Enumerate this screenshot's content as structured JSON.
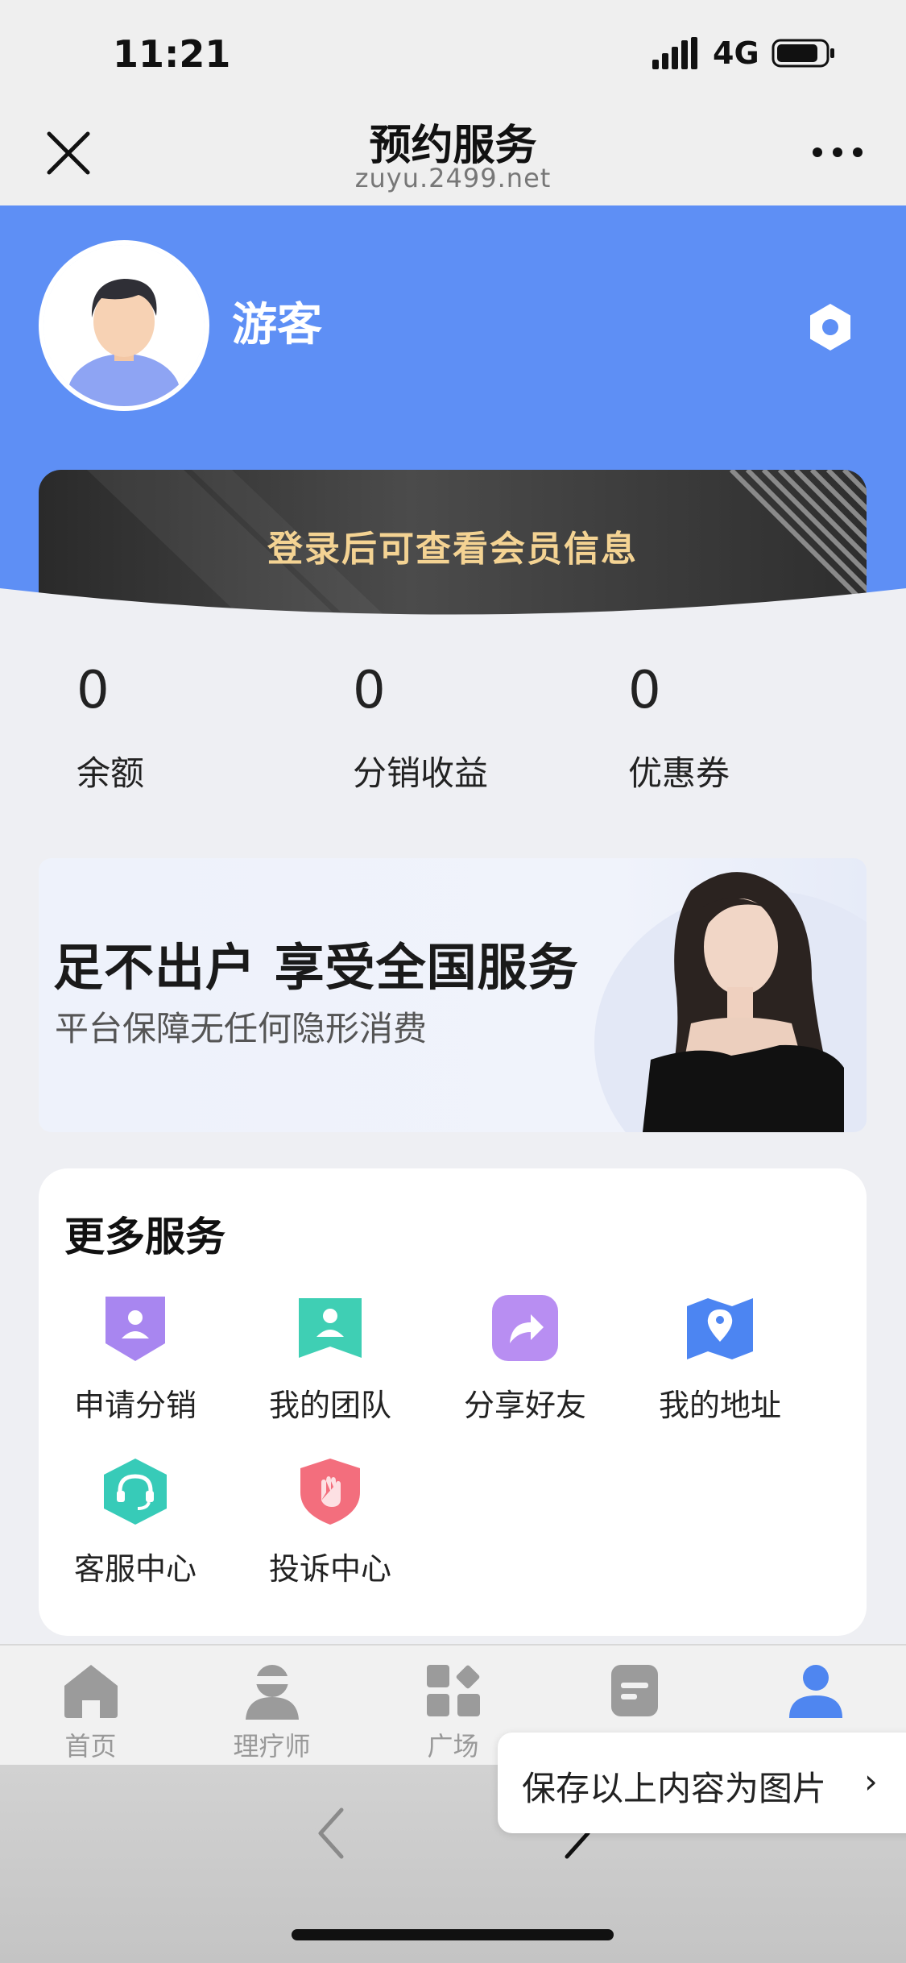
{
  "status_bar": {
    "time": "11:21",
    "network": "4G"
  },
  "header": {
    "title": "预约服务",
    "subtitle": "zuyu.2499.net"
  },
  "profile": {
    "username": "游客",
    "member_prompt": "登录后可查看会员信息"
  },
  "stats": [
    {
      "value": "0",
      "label": "余额"
    },
    {
      "value": "0",
      "label": "分销收益"
    },
    {
      "value": "0",
      "label": "优惠券"
    }
  ],
  "banner": {
    "title": "足不出户 享受全国服务",
    "subtitle": "平台保障无任何隐形消费"
  },
  "services": {
    "title": "更多服务",
    "items": [
      {
        "label": "申请分销",
        "icon": "badge-user-icon"
      },
      {
        "label": "我的团队",
        "icon": "team-icon"
      },
      {
        "label": "分享好友",
        "icon": "share-icon"
      },
      {
        "label": "我的地址",
        "icon": "map-pin-icon"
      },
      {
        "label": "客服中心",
        "icon": "headset-icon"
      },
      {
        "label": "投诉中心",
        "icon": "shield-hand-icon"
      }
    ]
  },
  "tabbar": [
    {
      "label": "首页",
      "icon": "home-icon"
    },
    {
      "label": "理疗师",
      "icon": "therapist-icon"
    },
    {
      "label": "广场",
      "icon": "grid-icon"
    },
    {
      "label": "",
      "icon": "orders-icon"
    },
    {
      "label": "",
      "icon": "profile-icon",
      "active": true
    }
  ],
  "save_popup": {
    "text": "保存以上内容为图片",
    "chevron": "›"
  },
  "colors": {
    "brand_blue": "#5e8ff5",
    "gold_text": "#f4d393",
    "tab_inactive": "#999999",
    "tab_active": "#4f86f0"
  }
}
